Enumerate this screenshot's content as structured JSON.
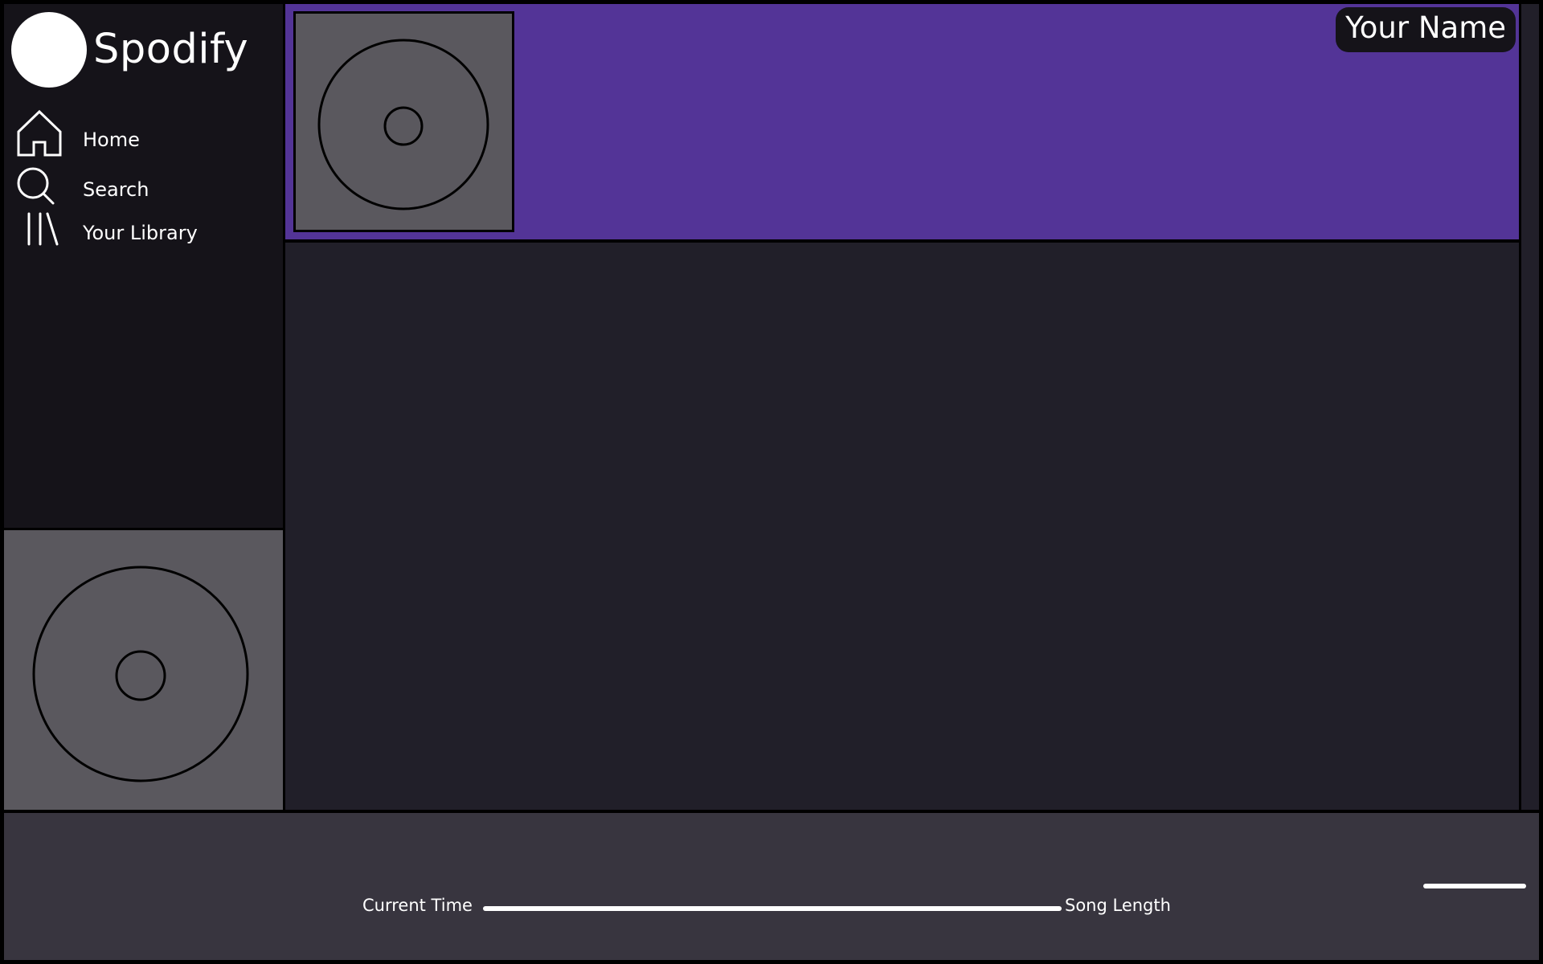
{
  "app": {
    "name": "Spodify"
  },
  "sidebar": {
    "items": [
      {
        "label": "Home",
        "icon": "home-icon"
      },
      {
        "label": "Search",
        "icon": "search-icon"
      },
      {
        "label": "Your Library",
        "icon": "library-icon"
      }
    ]
  },
  "header": {
    "user_label": "Your Name"
  },
  "player": {
    "current_time_label": "Current Time",
    "song_length_label": "Song Length"
  },
  "colors": {
    "accent": "#533497",
    "sidebar_bg": "#151319",
    "main_bg": "#211f29",
    "player_bg": "#38353f",
    "placeholder_art": "#5a585e"
  }
}
